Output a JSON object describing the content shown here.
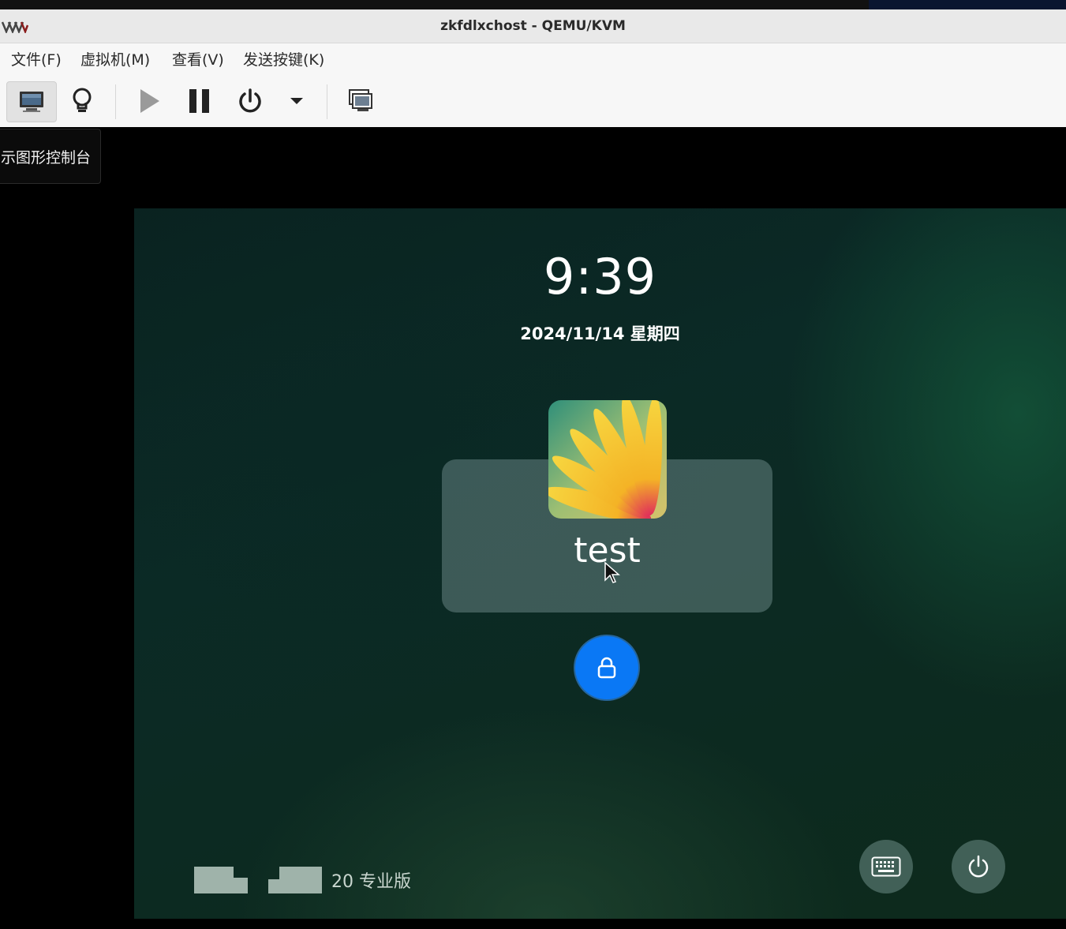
{
  "window": {
    "title": "zkfdlxchost - QEMU/KVM",
    "logo": "virt-manager-logo-icon"
  },
  "menu": {
    "items": [
      "文件(F)",
      "虚拟机(M)",
      "查看(V)",
      "发送按键(K)"
    ]
  },
  "toolbar": {
    "buttons": [
      {
        "name": "show-console-button",
        "icon": "monitor-icon",
        "active": true
      },
      {
        "name": "show-details-button",
        "icon": "lightbulb-icon"
      },
      {
        "name": "run-button",
        "icon": "play-icon",
        "enabled": false
      },
      {
        "name": "pause-button",
        "icon": "pause-icon"
      },
      {
        "name": "shutdown-button",
        "icon": "power-icon"
      },
      {
        "name": "shutdown-menu-button",
        "icon": "dropdown-arrow-icon"
      },
      {
        "name": "snapshots-button",
        "icon": "snapshots-icon"
      }
    ],
    "tooltip": "示图形控制台"
  },
  "lockscreen": {
    "time": "9:39",
    "date": "2024/11/14 星期四",
    "username": "test",
    "os_label": "20 专业版",
    "lock_icon": "lock-icon",
    "keyboard_icon": "keyboard-icon",
    "power_icon": "power-icon"
  },
  "colors": {
    "accent": "#0a78f5",
    "titlebar_bg": "#e9e9e9",
    "menubar_bg": "#f7f7f7"
  }
}
